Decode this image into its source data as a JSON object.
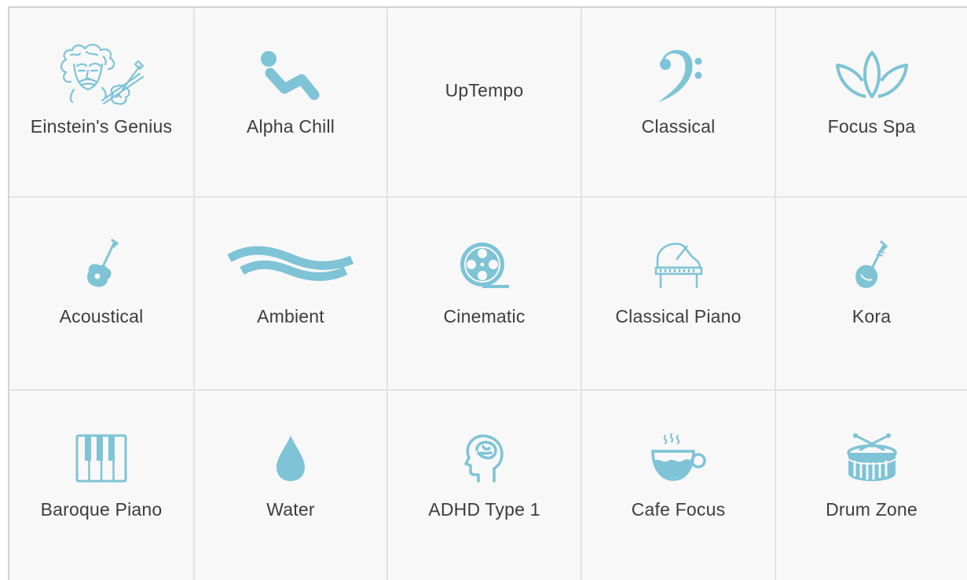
{
  "accent_color": "#7ec3d6",
  "tiles": [
    {
      "label": "Einstein's Genius",
      "icon": "einstein-violin-icon"
    },
    {
      "label": "Alpha Chill",
      "icon": "reclining-person-icon"
    },
    {
      "label": "UpTempo",
      "icon": ""
    },
    {
      "label": "Classical",
      "icon": "bass-clef-icon"
    },
    {
      "label": "Focus Spa",
      "icon": "lotus-icon"
    },
    {
      "label": "Acoustical",
      "icon": "guitar-icon"
    },
    {
      "label": "Ambient",
      "icon": "wave-icon"
    },
    {
      "label": "Cinematic",
      "icon": "film-reel-icon"
    },
    {
      "label": "Classical Piano",
      "icon": "grand-piano-icon"
    },
    {
      "label": "Kora",
      "icon": "kora-icon"
    },
    {
      "label": "Baroque Piano",
      "icon": "piano-keys-icon"
    },
    {
      "label": "Water",
      "icon": "water-drop-icon"
    },
    {
      "label": "ADHD Type 1",
      "icon": "head-brain-icon"
    },
    {
      "label": "Cafe Focus",
      "icon": "coffee-cup-icon"
    },
    {
      "label": "Drum Zone",
      "icon": "drum-icon"
    }
  ]
}
